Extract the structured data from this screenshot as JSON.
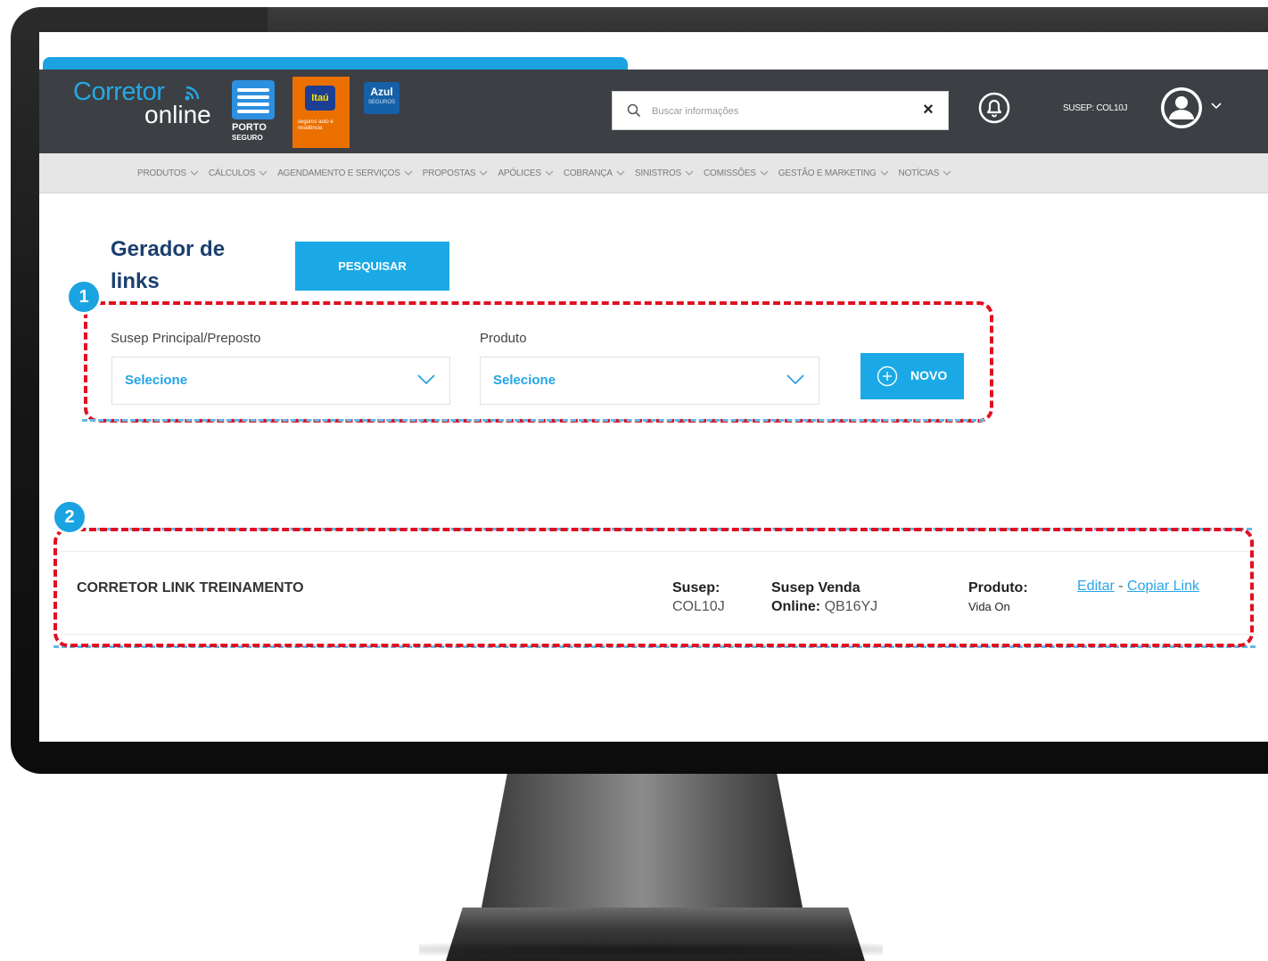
{
  "header": {
    "logo": {
      "brand_top": "Corretor",
      "brand_bottom": "online"
    },
    "partners": {
      "porto": {
        "line1": "PORTO",
        "line2": "SEGURO"
      },
      "itau": {
        "name": "Itaú",
        "sub": "seguros auto e residência"
      },
      "azul": {
        "name": "Azul",
        "sub": "SEGUROS"
      }
    },
    "search": {
      "placeholder": "Buscar informações",
      "value": ""
    },
    "user": {
      "susep": "SUSEP: COL10J"
    }
  },
  "nav": {
    "items": [
      {
        "label": "PRODUTOS"
      },
      {
        "label": "CÁLCULOS"
      },
      {
        "label": "AGENDAMENTO E SERVIÇOS"
      },
      {
        "label": "PROPOSTAS"
      },
      {
        "label": "APÓLICES"
      },
      {
        "label": "COBRANÇA"
      },
      {
        "label": "SINISTROS"
      },
      {
        "label": "COMISSÕES"
      },
      {
        "label": "GESTÃO E MARKETING"
      },
      {
        "label": "NOTÍCIAS"
      }
    ]
  },
  "page": {
    "title": "Gerador de links",
    "search_button": "PESQUISAR"
  },
  "filters": {
    "step_number": "1",
    "susep_field": {
      "label": "Susep Principal/Preposto",
      "value": "Selecione"
    },
    "produto_field": {
      "label": "Produto",
      "value": "Selecione"
    },
    "new_button": "NOVO"
  },
  "results": {
    "step_number": "2",
    "items": [
      {
        "name": "CORRETOR LINK TREINAMENTO",
        "susep_label": "Susep:",
        "susep_value": "COL10J",
        "susep_venda_label_1": "Susep Venda",
        "susep_venda_label_2": "Online:",
        "susep_venda_value": "QB16YJ",
        "produto_label": "Produto:",
        "produto_value": "Vida On",
        "edit_label": "Editar",
        "separator": "-",
        "copy_label": "Copiar Link"
      }
    ]
  },
  "colors": {
    "brand_blue": "#1aa9e6",
    "header_bg": "#3c3f43",
    "nav_bg": "#e6e6e6",
    "title_navy": "#1b3f6e",
    "highlight_red": "#e01020"
  }
}
